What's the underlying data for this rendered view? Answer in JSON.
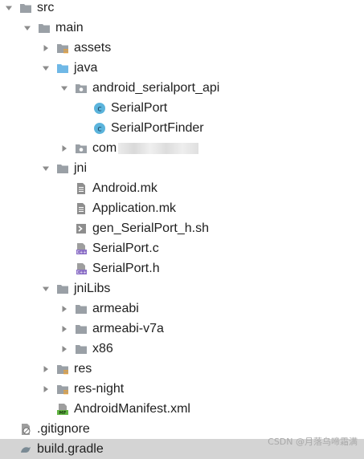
{
  "colors": {
    "folder": "#9aa0a6",
    "folder_java": "#6fb8e6",
    "class_icon": "#5bb4dc",
    "cpp_icon": "#8b6fc6",
    "arrow": "#8c8c8c",
    "selected_row": "#d4d4d4"
  },
  "tree": {
    "items": [
      {
        "label": "src",
        "depth": 0,
        "arrow": "expanded",
        "icon": "folder-icon",
        "partial_top": true
      },
      {
        "label": "main",
        "depth": 1,
        "arrow": "expanded",
        "icon": "folder-icon"
      },
      {
        "label": "assets",
        "depth": 2,
        "arrow": "collapsed",
        "icon": "resource-folder-icon"
      },
      {
        "label": "java",
        "depth": 2,
        "arrow": "expanded",
        "icon": "source-folder-icon"
      },
      {
        "label": "android_serialport_api",
        "depth": 3,
        "arrow": "expanded",
        "icon": "package-icon"
      },
      {
        "label": "SerialPort",
        "depth": 4,
        "arrow": "none",
        "icon": "class-icon"
      },
      {
        "label": "SerialPortFinder",
        "depth": 4,
        "arrow": "none",
        "icon": "class-icon"
      },
      {
        "label": "com",
        "depth": 3,
        "arrow": "collapsed",
        "icon": "package-icon",
        "redacted": true
      },
      {
        "label": "jni",
        "depth": 2,
        "arrow": "expanded",
        "icon": "folder-icon"
      },
      {
        "label": "Android.mk",
        "depth": 3,
        "arrow": "none",
        "icon": "text-file-icon"
      },
      {
        "label": "Application.mk",
        "depth": 3,
        "arrow": "none",
        "icon": "text-file-icon"
      },
      {
        "label": "gen_SerialPort_h.sh",
        "depth": 3,
        "arrow": "none",
        "icon": "shell-script-icon"
      },
      {
        "label": "SerialPort.c",
        "depth": 3,
        "arrow": "none",
        "icon": "cpp-file-icon"
      },
      {
        "label": "SerialPort.h",
        "depth": 3,
        "arrow": "none",
        "icon": "cpp-file-icon"
      },
      {
        "label": "jniLibs",
        "depth": 2,
        "arrow": "expanded",
        "icon": "folder-icon"
      },
      {
        "label": "armeabi",
        "depth": 3,
        "arrow": "collapsed",
        "icon": "folder-icon"
      },
      {
        "label": "armeabi-v7a",
        "depth": 3,
        "arrow": "collapsed",
        "icon": "folder-icon"
      },
      {
        "label": "x86",
        "depth": 3,
        "arrow": "collapsed",
        "icon": "folder-icon"
      },
      {
        "label": "res",
        "depth": 2,
        "arrow": "collapsed",
        "icon": "resource-folder-icon"
      },
      {
        "label": "res-night",
        "depth": 2,
        "arrow": "collapsed",
        "icon": "resource-folder-icon"
      },
      {
        "label": "AndroidManifest.xml",
        "depth": 2,
        "arrow": "none",
        "icon": "manifest-file-icon"
      },
      {
        "label": ".gitignore",
        "depth": 0,
        "arrow": "none",
        "icon": "gitignore-file-icon"
      },
      {
        "label": "build.gradle",
        "depth": 0,
        "arrow": "none",
        "icon": "gradle-file-icon",
        "selected": true
      }
    ]
  },
  "watermark": "CSDN @月落乌啼霜满"
}
